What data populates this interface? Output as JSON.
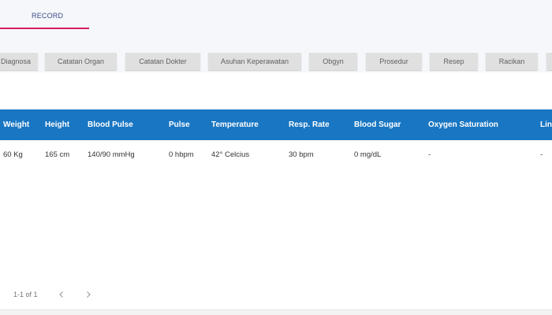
{
  "header": {
    "record_tab": "RECORD"
  },
  "subtabs": [
    "Diagnosa",
    "Catatan Organ",
    "Catatan Dokter",
    "Asuhan Keperawatan",
    "Obgyn",
    "Prosedur",
    "Resep",
    "Racikan",
    ""
  ],
  "table": {
    "headers": [
      "Weight",
      "Height",
      "Blood Pulse",
      "Pulse",
      "Temperature",
      "Resp. Rate",
      "Blood Sugar",
      "Oxygen Saturation",
      "Lingkar"
    ],
    "row": [
      "60 Kg",
      "165 cm",
      "140/90 mmHg",
      "0 hbpm",
      "42° Celcius",
      "30 bpm",
      "0 mg/dL",
      "-",
      "-"
    ]
  },
  "pagination": {
    "range_text": "1-1 of 1",
    "prev_icon": "chevron-left-icon",
    "next_icon": "chevron-right-icon"
  },
  "colors": {
    "accent_underline": "#d81b60",
    "table_header": "#1976c2",
    "subtab_bg": "#e0e0e0",
    "top_band": "#f5f7fa"
  }
}
